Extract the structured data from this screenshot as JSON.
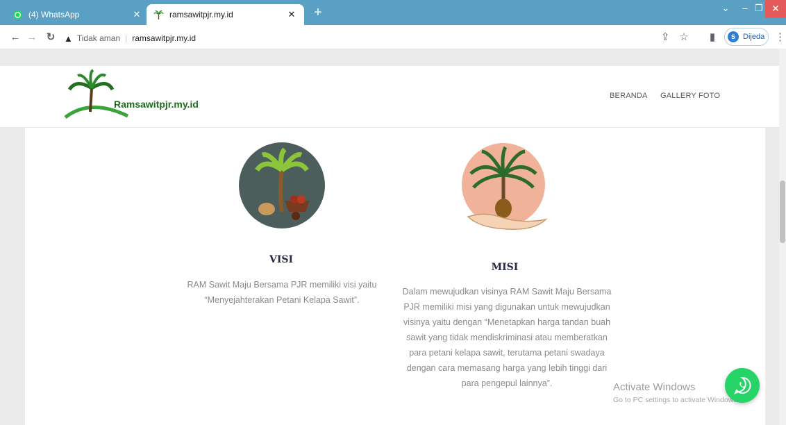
{
  "browser": {
    "tabs": [
      {
        "title": "(4) WhatsApp",
        "active": false
      },
      {
        "title": "ramsawitpjr.my.id",
        "active": true
      }
    ],
    "new_tab": "+",
    "address": {
      "security_label": "Tidak aman",
      "url": "ramsawitpjr.my.id"
    },
    "profile": {
      "initial": "S",
      "name": "Dijeda"
    }
  },
  "site": {
    "logo_text": "Ramsawitpjr.my.id",
    "nav": [
      "BERANDA",
      "GALLERY FOTO"
    ]
  },
  "sections": {
    "visi": {
      "title": "VISI",
      "text": "RAM Sawit Maju Bersama PJR memiliki visi yaitu “Menyejahterakan Petani Kelapa Sawit”."
    },
    "misi": {
      "title": "MISI",
      "text": "Dalam mewujudkan visinya RAM Sawit Maju Bersama PJR memiliki misi yang digunakan untuk mewujudkan visinya yaitu dengan “Menetapkan harga tandan buah sawit yang tidak mendiskriminasi atau memberatkan para petani kelapa sawit, terutama petani swadaya dengan cara memasang harga yang lebih tinggi dari para pengepul lainnya”."
    }
  },
  "watermark": {
    "title": "Activate Windows",
    "subtitle": "Go to PC settings to activate Windows."
  },
  "colors": {
    "tab_bar": "#5aa0c4",
    "heading": "#262a45",
    "body_text": "#8a8a8a",
    "logo_green": "#1e6b1e",
    "whatsapp_green": "#25d366"
  }
}
